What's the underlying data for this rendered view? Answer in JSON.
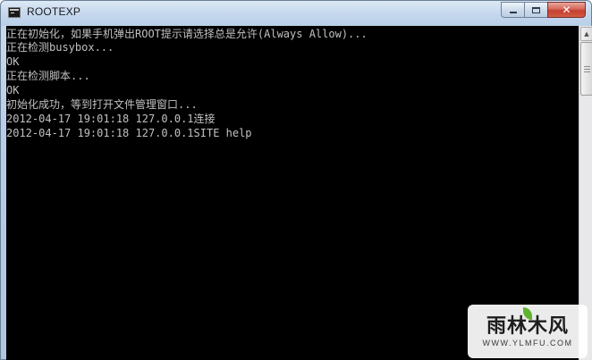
{
  "window": {
    "title": "ROOTEXP",
    "icon": "console-icon",
    "buttons": {
      "minimize": "minimize-icon",
      "maximize": "maximize-icon",
      "close_label": "✕"
    }
  },
  "console": {
    "background": "#000000",
    "text_color": "#c0c0c0",
    "lines": [
      "正在初始化，如果手机弹出ROOT提示请选择总是允许(Always Allow)...",
      "正在检测busybox...",
      "OK",
      "正在检测脚本...",
      "OK",
      "初始化成功，等到打开文件管理窗口...",
      "2012-04-17 19:01:18 127.0.0.1连接",
      "2012-04-17 19:01:18 127.0.0.1SITE help"
    ]
  },
  "watermark": {
    "logo": "雨林木风",
    "url": "WWW.YLMFU.COM"
  }
}
